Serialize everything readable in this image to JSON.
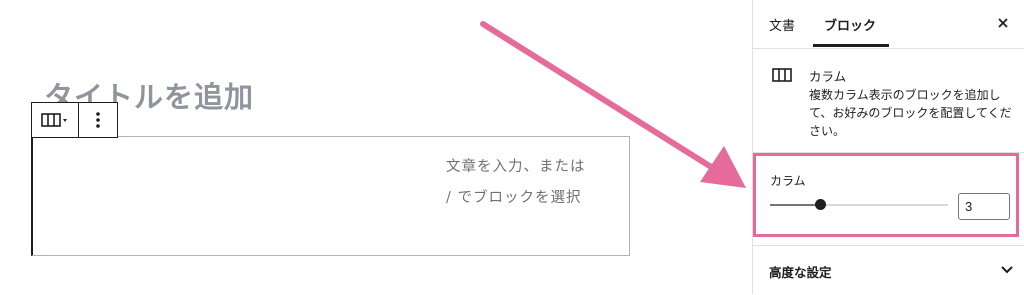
{
  "editor": {
    "title_placeholder": "タイトルを追加",
    "column_placeholder": "文章を入力、または / でブロックを選択",
    "toolbar": {
      "block_type_icon": "columns-icon",
      "more_icon": "more-vertical-icon"
    }
  },
  "sidebar": {
    "tabs": [
      {
        "label": "文書",
        "active": false
      },
      {
        "label": "ブロック",
        "active": true
      }
    ],
    "close_icon": "close-icon",
    "block_card": {
      "icon": "columns-icon",
      "title": "カラム",
      "description": "複数カラム表示のブロックを追加して、お好みのブロックを配置してください。"
    },
    "columns_setting": {
      "label": "カラム",
      "value": "3",
      "slider_fraction": 0.28
    },
    "advanced": {
      "label": "高度な設定",
      "icon": "chevron-down-icon"
    }
  },
  "colors": {
    "highlight": "#e56b9b",
    "arrow": "#e56b9b",
    "text": "#1e1e1e",
    "title_placeholder": "#8f959b"
  }
}
